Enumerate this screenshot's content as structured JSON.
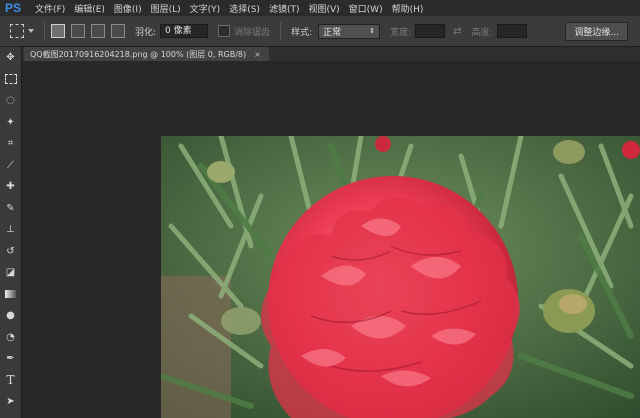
{
  "app": {
    "logo": "PS"
  },
  "menu": [
    "文件(F)",
    "编辑(E)",
    "图像(I)",
    "图层(L)",
    "文字(Y)",
    "选择(S)",
    "滤镜(T)",
    "视图(V)",
    "窗口(W)",
    "帮助(H)"
  ],
  "options": {
    "feather_label": "羽化:",
    "feather_value": "0 像素",
    "antialias_label": "消除锯齿",
    "style_label": "样式:",
    "style_value": "正常",
    "width_label": "宽度:",
    "height_label": "高度:",
    "refine_edge_button": "调整边缘..."
  },
  "document_tab": {
    "title": "QQ截图20170916204218.png @ 100% (图层 0, RGB/8)",
    "close": "×"
  },
  "tools": [
    "move-icon",
    "marquee-icon",
    "lasso-icon",
    "magic-wand-icon",
    "crop-icon",
    "eyedropper-icon",
    "healing-brush-icon",
    "brush-icon",
    "clone-stamp-icon",
    "history-brush-icon",
    "eraser-icon",
    "gradient-icon",
    "blur-icon",
    "dodge-icon",
    "pen-icon",
    "type-icon",
    "path-select-icon"
  ],
  "colors": {
    "accent": "#3a8ee6",
    "flower": "#e8344a",
    "foliage": "#3f6b3a"
  }
}
